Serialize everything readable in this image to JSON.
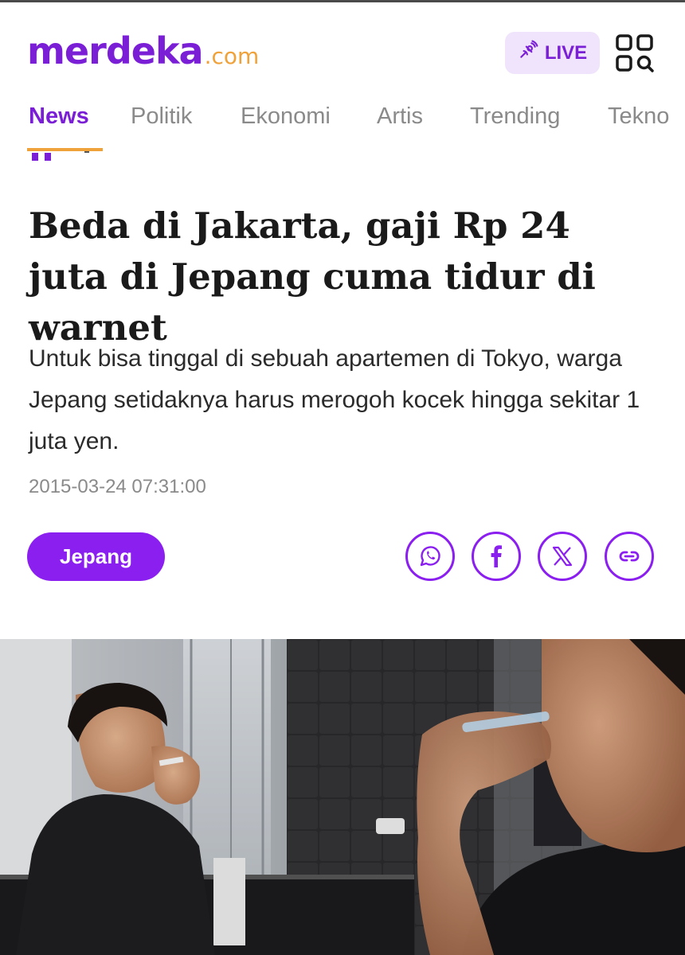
{
  "header": {
    "logo_main": "merdeka",
    "logo_suffix": ".com",
    "live_label": "LIVE",
    "live_icon": "broadcast-icon",
    "menu_icon": "grid-search-icon"
  },
  "nav": {
    "items": [
      "News",
      "Politik",
      "Ekonomi",
      "Artis",
      "Trending",
      "Tekno"
    ],
    "active": "News"
  },
  "article": {
    "headline": "Beda di Jakarta, gaji Rp 24 juta di Jepang cuma tidur di warnet",
    "lede": "Untuk bisa tinggal di sebuah apartemen di Tokyo, warga Jepang setidaknya harus merogoh kocek hingga sekitar 1 juta yen.",
    "date": "2015-03-24 07:31:00",
    "tag": "Jepang"
  },
  "share": {
    "icons": [
      "whatsapp-icon",
      "facebook-icon",
      "x-icon",
      "link-icon"
    ]
  },
  "colors": {
    "brand_purple": "#7a1fd6",
    "accent_orange": "#f0a23a",
    "tag_purple": "#8a1ff0"
  }
}
